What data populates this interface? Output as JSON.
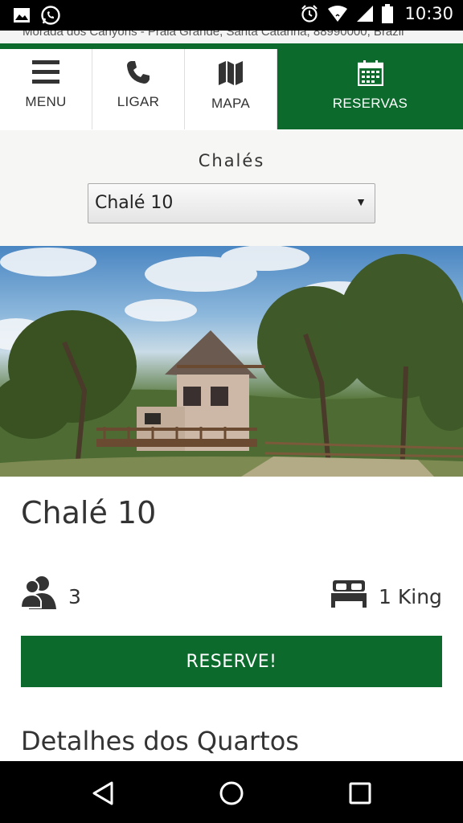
{
  "status_bar": {
    "time": "10:30",
    "icons": [
      "image-icon",
      "whatsapp-icon",
      "alarm-icon",
      "wifi-icon",
      "signal-icon",
      "battery-icon"
    ]
  },
  "address_bar": {
    "text": "Morada dos Canyons - Praia Grande, Santa Catarina, 88990000, Brazil"
  },
  "nav": {
    "items": [
      {
        "label": "MENU",
        "icon": "hamburger-menu-icon"
      },
      {
        "label": "LIGAR",
        "icon": "phone-icon"
      },
      {
        "label": "MAPA",
        "icon": "map-icon"
      },
      {
        "label": "RESERVAS",
        "icon": "calendar-icon",
        "active": true
      }
    ]
  },
  "selector": {
    "label": "Chalés",
    "selected": "Chalé 10"
  },
  "room": {
    "title": "Chalé 10",
    "guests": "3",
    "bed": "1 King",
    "reserve_label": "RESERVE!",
    "details_heading": "Detalhes dos Quartos"
  },
  "colors": {
    "brand_green": "#0b6a2c"
  },
  "system_nav": {
    "icons": [
      "back-icon",
      "home-icon",
      "recents-icon"
    ]
  }
}
